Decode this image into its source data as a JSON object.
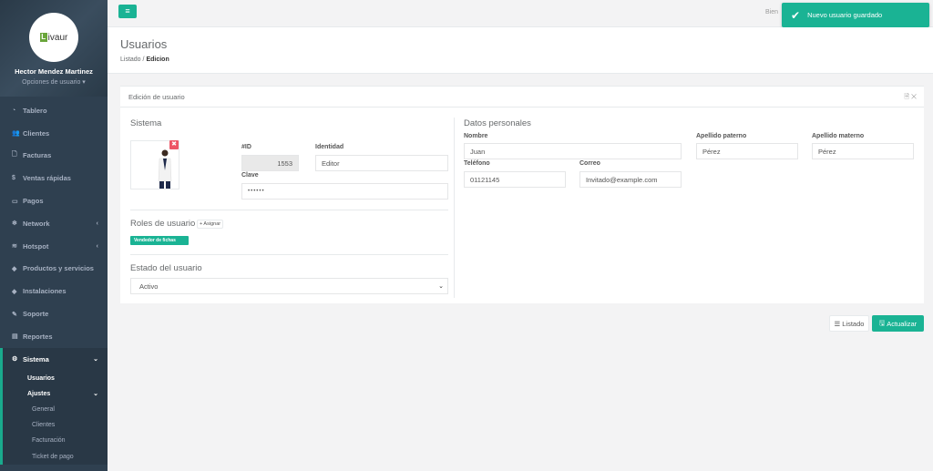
{
  "sidebar": {
    "logo_text": "ivaur",
    "logo_letter": "L",
    "user_name": "Hector Mendez Martinez",
    "user_options": "Opciones de usuario ▾",
    "items": [
      {
        "label": "Tablero",
        "icon": "dashboard-icon"
      },
      {
        "label": "Clientes",
        "icon": "users-icon"
      },
      {
        "label": "Facturas",
        "icon": "file-icon"
      },
      {
        "label": "Ventas rápidas",
        "icon": "dollar-icon"
      },
      {
        "label": "Pagos",
        "icon": "money-icon"
      },
      {
        "label": "Network",
        "icon": "network-icon"
      },
      {
        "label": "Hotspot",
        "icon": "wifi-icon"
      },
      {
        "label": "Productos y servicios",
        "icon": "tag-icon"
      },
      {
        "label": "Instalaciones",
        "icon": "tag-icon"
      },
      {
        "label": "Soporte",
        "icon": "wrench-icon"
      },
      {
        "label": "Reportes",
        "icon": "book-icon"
      },
      {
        "label": "Sistema",
        "icon": "gears-icon"
      }
    ],
    "sub_items": [
      "Usuarios",
      "Ajustes"
    ],
    "ajustes_items": [
      "General",
      "Clientes",
      "Facturación",
      "Ticket de pago"
    ]
  },
  "topbar": {
    "welcome": "Bien",
    "toast": "Nuevo usuario guardado"
  },
  "heading": {
    "title": "Usuarios",
    "crumb_1": "Listado",
    "crumb_sep": "/",
    "crumb_2": "Edicion"
  },
  "panel": {
    "title": "Edición de usuario",
    "tools": "🗎 ✕",
    "sistema": {
      "title": "Sistema",
      "id_label": "#ID",
      "id_value": "1553",
      "identidad_label": "Identidad",
      "identidad_value": "Editor",
      "clave_label": "Clave",
      "clave_value": "••••••"
    },
    "roles": {
      "title": "Roles de usuario",
      "assign": "+ Asignar",
      "badge": "Vendedor de fichas"
    },
    "estado": {
      "title": "Estado del usuario",
      "selected": "Activo"
    },
    "personal": {
      "title": "Datos personales",
      "nombre_label": "Nombre",
      "nombre_value": "Juan",
      "apat_label": "Apellido paterno",
      "apat_value": "Pérez",
      "amat_label": "Apellido materno",
      "amat_value": "Pérez",
      "tel_label": "Teléfono",
      "tel_value": "01121145",
      "correo_label": "Correo",
      "correo_placeholder": "Invitado@example.com"
    }
  },
  "buttons": {
    "list": "Listado",
    "update": "Actualizar"
  }
}
